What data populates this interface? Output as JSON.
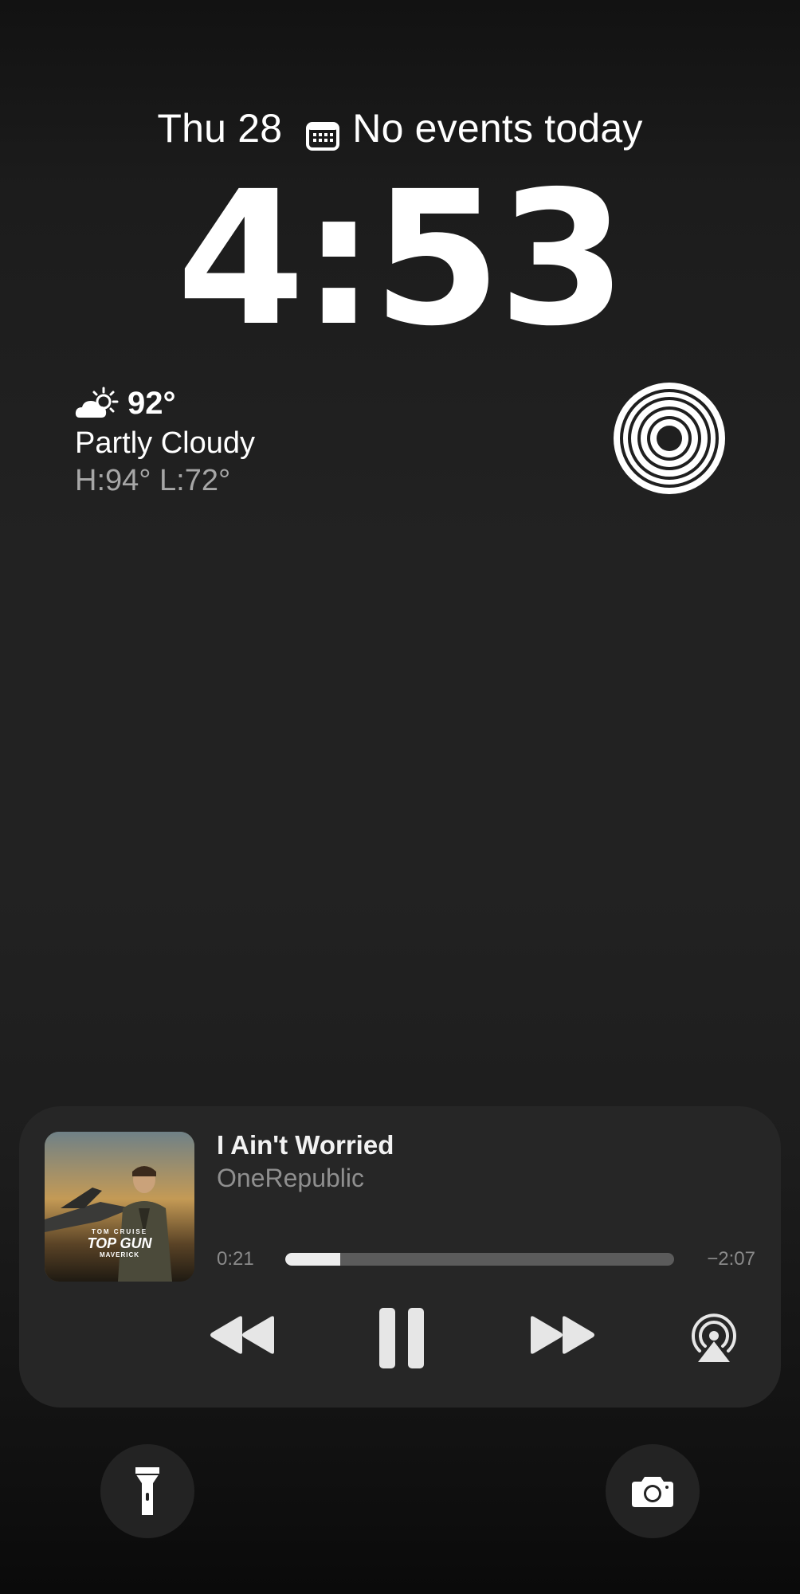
{
  "lock_screen": {
    "date": "Thu 28",
    "calendar_status": "No events today",
    "time": "4:53"
  },
  "weather": {
    "icon": "partly-cloudy-icon",
    "temperature": "92°",
    "condition": "Partly Cloudy",
    "high_low": "H:94° L:72°"
  },
  "activity_widget": {
    "icon": "activity-rings-icon"
  },
  "now_playing": {
    "title": "I Ain't Worried",
    "artist": "OneRepublic",
    "elapsed": "0:21",
    "remaining": "−2:07",
    "progress_fraction": 0.142,
    "album_art": {
      "icon": "album-art",
      "lettering": [
        "TOM CRUISE",
        "TOP GUN",
        "MAVERICK"
      ]
    },
    "controls": {
      "rewind": "rewind-icon",
      "pause": "pause-icon",
      "fast_forward": "fast-forward-icon",
      "airplay": "airplay-audio-icon"
    }
  },
  "quick_actions": {
    "left": "flashlight-icon",
    "right": "camera-icon"
  },
  "colors": {
    "background": "#1f1f1f",
    "player_card": "#262626",
    "secondary_text": "#8f8f8f",
    "progress_track": "#5b5b5b",
    "progress_fill": "#ededed"
  }
}
